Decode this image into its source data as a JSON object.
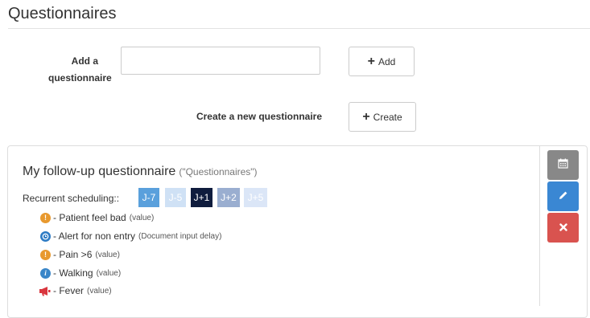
{
  "page_title": "Questionnaires",
  "add_form": {
    "label_line1": "Add a",
    "label_line2": "questionnaire",
    "input_value": "",
    "input_placeholder": "",
    "add_button_label": "Add",
    "create_label": "Create a new questionnaire",
    "create_button_label": "Create"
  },
  "questionnaire": {
    "title": "My follow-up questionnaire",
    "subtitle": "(\"Questionnaires\")",
    "scheduling_label": "Recurrent scheduling::",
    "chips": [
      {
        "label": "J-7",
        "color": "#5aa0dc",
        "text_color": "#ffffff"
      },
      {
        "label": "J-5",
        "color": "#cfe1f5",
        "text_color": "#ffffff"
      },
      {
        "label": "J+1",
        "color": "#0f1c3d",
        "text_color": "#ffffff"
      },
      {
        "label": "J+2",
        "color": "#9aaed0",
        "text_color": "#ffffff"
      },
      {
        "label": "J+5",
        "color": "#dbe6f7",
        "text_color": "#ffffff"
      }
    ],
    "alerts": [
      {
        "icon": "exclamation-circle-icon",
        "icon_color": "#e8992e",
        "label": "- Patient feel bad",
        "detail": "(value)"
      },
      {
        "icon": "clock-icon",
        "icon_color": "#2f7cc4",
        "label": "- Alert for non entry",
        "detail": "(Document input delay)"
      },
      {
        "icon": "exclamation-circle-icon",
        "icon_color": "#e8992e",
        "label": "- Pain >6",
        "detail": "(value)"
      },
      {
        "icon": "info-circle-icon",
        "icon_color": "#3a86c8",
        "label": "- Walking",
        "detail": "(value)"
      },
      {
        "icon": "megaphone-icon",
        "icon_color": "#d9363e",
        "label": "- Fever",
        "detail": "(value)"
      }
    ]
  },
  "actions": [
    {
      "name": "calendar",
      "icon": "calendar-icon",
      "color": "#888888"
    },
    {
      "name": "edit",
      "icon": "pencil-icon",
      "color": "#3a87d3"
    },
    {
      "name": "delete",
      "icon": "close-icon",
      "color": "#d9534f"
    }
  ]
}
